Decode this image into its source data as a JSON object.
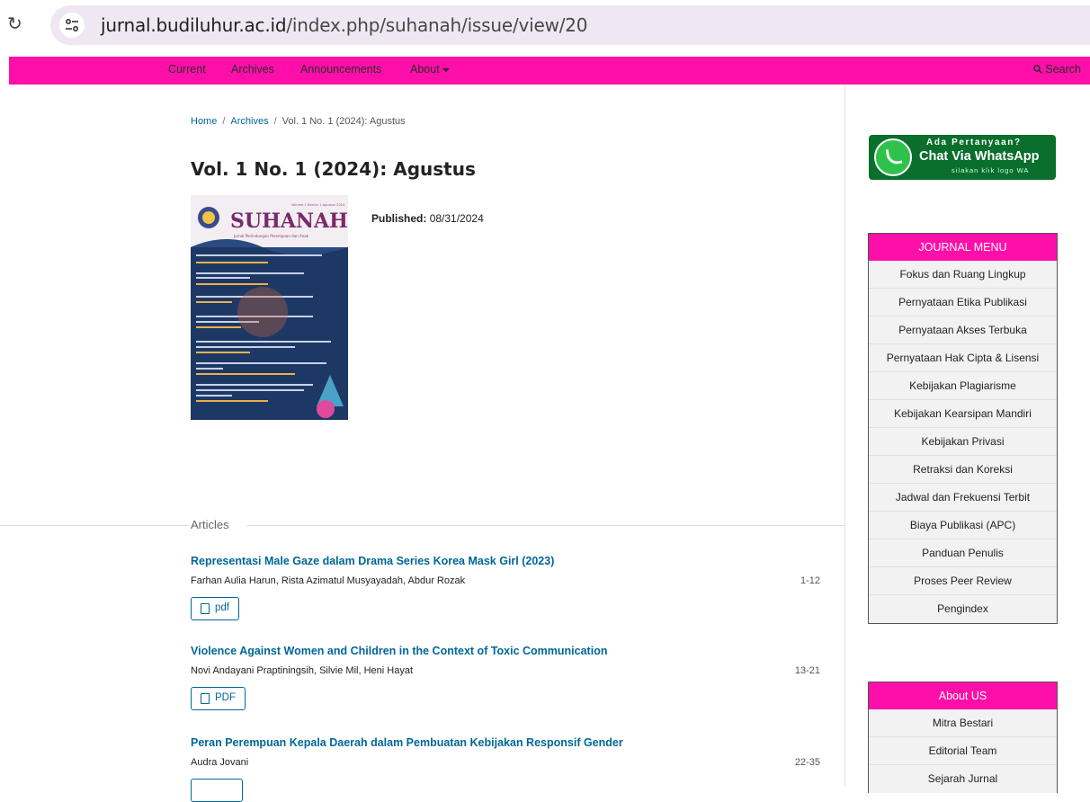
{
  "browser": {
    "url_host": "jurnal.budiluhur.ac.id",
    "url_path": "/index.php/suhanah/issue/view/20"
  },
  "nav": {
    "items": [
      "Current",
      "Archives",
      "Announcements",
      "About"
    ],
    "search_label": "Search"
  },
  "breadcrumb": {
    "home": "Home",
    "archives": "Archives",
    "sep": "/",
    "current": "Vol. 1 No. 1 (2024): Agustus"
  },
  "issue": {
    "title": "Vol. 1 No. 1 (2024): Agustus",
    "published_label": "Published:",
    "published_date": "08/31/2024",
    "cover": {
      "journal_name": "SUHANAH",
      "subtitle": "Jurnal Perlindungan Perempuan dan Anak",
      "volume": "Volume 1 Nomor 1 Agustus 2024"
    }
  },
  "articles_heading": "Articles",
  "articles": [
    {
      "title": "Representasi Male Gaze dalam Drama Series Korea Mask Girl (2023)",
      "authors": "Farhan Aulia Harun, Rista Azimatul Musyayadah, Abdur Rozak",
      "pages": "1-12",
      "galley": "pdf"
    },
    {
      "title": "Violence Against Women and Children in the Context of Toxic Communication",
      "authors": "Novi Andayani Praptiningsih, Silvie Mil, Heni Hayat",
      "pages": "13-21",
      "galley": "PDF"
    },
    {
      "title": "Peran Perempuan Kepala Daerah dalam Pembuatan Kebijakan Responsif Gender",
      "authors": "Audra Jovani",
      "pages": "22-35",
      "galley": ""
    }
  ],
  "whatsapp": {
    "line1": "Ada Pertanyaan?",
    "line2": "Chat Via WhatsApp",
    "line3": "silakan klik logo WA"
  },
  "journal_menu": {
    "heading": "JOURNAL MENU",
    "items": [
      "Fokus dan Ruang Lingkup",
      "Pernyataan Etika Publikasi",
      "Pernyataan Akses Terbuka",
      "Pernyataan Hak Cipta & Lisensi",
      "Kebijakan Plagiarisme",
      "Kebijakan Kearsipan Mandiri",
      "Kebijakan Privasi",
      "Retraksi dan Koreksi",
      "Jadwal dan Frekuensi Terbit",
      "Biaya Publikasi (APC)",
      "Panduan Penulis",
      "Proses Peer Review",
      "Pengindex"
    ]
  },
  "about_us": {
    "heading": "About US",
    "items": [
      "Mitra Bestari",
      "Editorial Team",
      "Sejarah Jurnal"
    ]
  },
  "colors": {
    "nav_bg": "#ff0fa9",
    "link": "#006798",
    "whatsapp": "#0a6e2c"
  }
}
